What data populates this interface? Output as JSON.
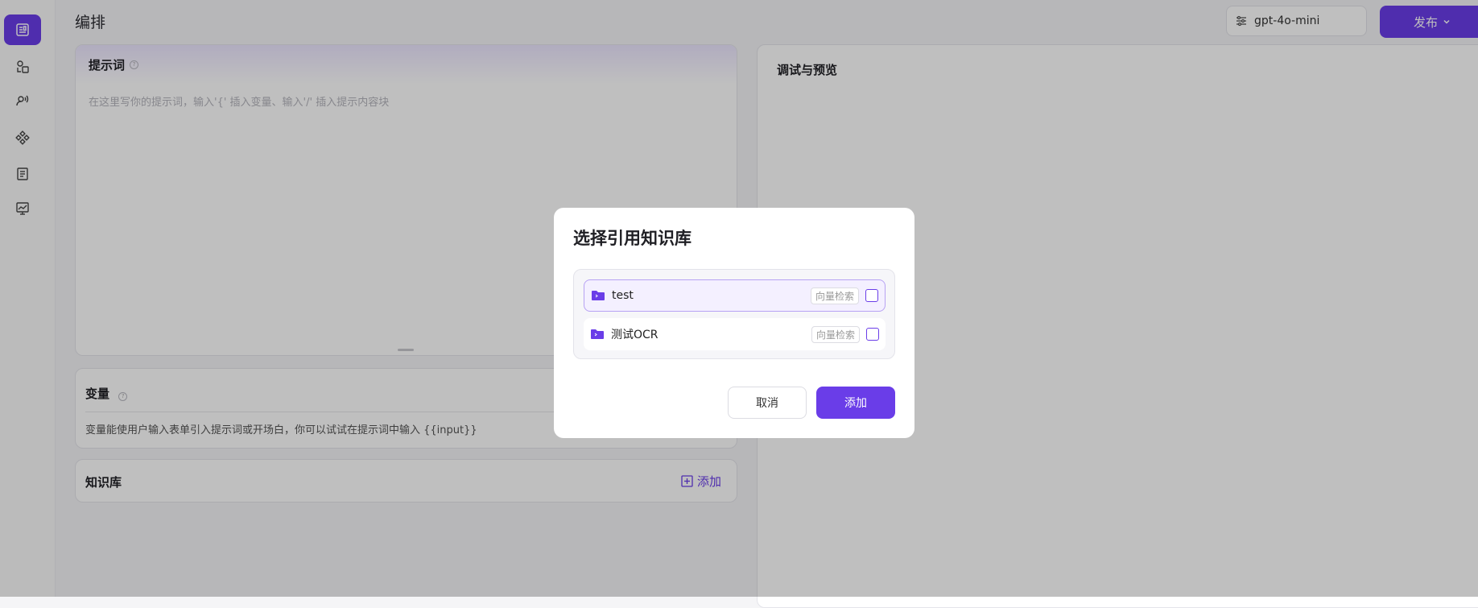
{
  "sidebar": {
    "items": [
      {
        "icon": "dashboard-icon",
        "active": true
      },
      {
        "icon": "plugin-icon",
        "active": false
      },
      {
        "icon": "voice-icon",
        "active": false
      },
      {
        "icon": "workflow-icon",
        "active": false
      },
      {
        "icon": "document-icon",
        "active": false
      },
      {
        "icon": "analytics-icon",
        "active": false
      }
    ]
  },
  "header": {
    "title": "编排",
    "model": "gpt-4o-mini",
    "publish_label": "发布"
  },
  "prompt": {
    "title": "提示词",
    "placeholder": "在这里写你的提示词，输入'{' 插入变量、输入'/' 插入提示内容块"
  },
  "variables": {
    "title": "变量",
    "description": "变量能使用户输入表单引入提示词或开场白，你可以试试在提示词中输入 {{input}}"
  },
  "knowledge": {
    "title": "知识库",
    "add_label": "添加"
  },
  "debug": {
    "title": "调试与预览"
  },
  "modal": {
    "title": "选择引用知识库",
    "items": [
      {
        "name": "test",
        "tag": "向量检索",
        "selected": true
      },
      {
        "name": "测试OCR",
        "tag": "向量检索",
        "selected": false
      }
    ],
    "cancel_label": "取消",
    "add_label": "添加"
  },
  "colors": {
    "accent": "#6a3de8"
  }
}
